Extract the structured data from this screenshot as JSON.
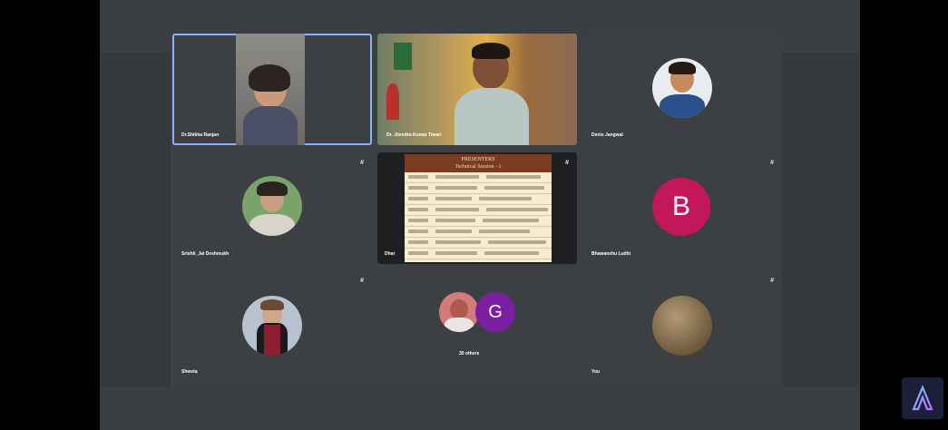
{
  "meeting": {
    "tiles": [
      {
        "name": "Dr.Shikha Ranjan",
        "active": true
      },
      {
        "name": "Dr. Jitendra Kumar Tiwari"
      },
      {
        "name": "Denis Jangwal"
      },
      {
        "name": "Srishti_Jai Deshmukh",
        "mute": "#"
      },
      {
        "name": "Dhar",
        "mute": "#"
      },
      {
        "name": "Bhawanshu Ludhi",
        "mute": "#",
        "avatar_letter": "B",
        "avatar_color": "#c2185b"
      },
      {
        "name": "Shweta",
        "mute": "#"
      },
      {
        "name": "30 others",
        "avatar_letter": "G",
        "avatar_color": "#7b1fa2"
      },
      {
        "name": "You",
        "mute": "#"
      }
    ],
    "slide": {
      "title": "PRESENTERS",
      "subtitle": "Technical Session - 1"
    }
  },
  "colors": {
    "active_border": "#8ab4f8",
    "tile_bg": "#3c4043"
  },
  "logo": {
    "icon": "app-logo-icon"
  }
}
